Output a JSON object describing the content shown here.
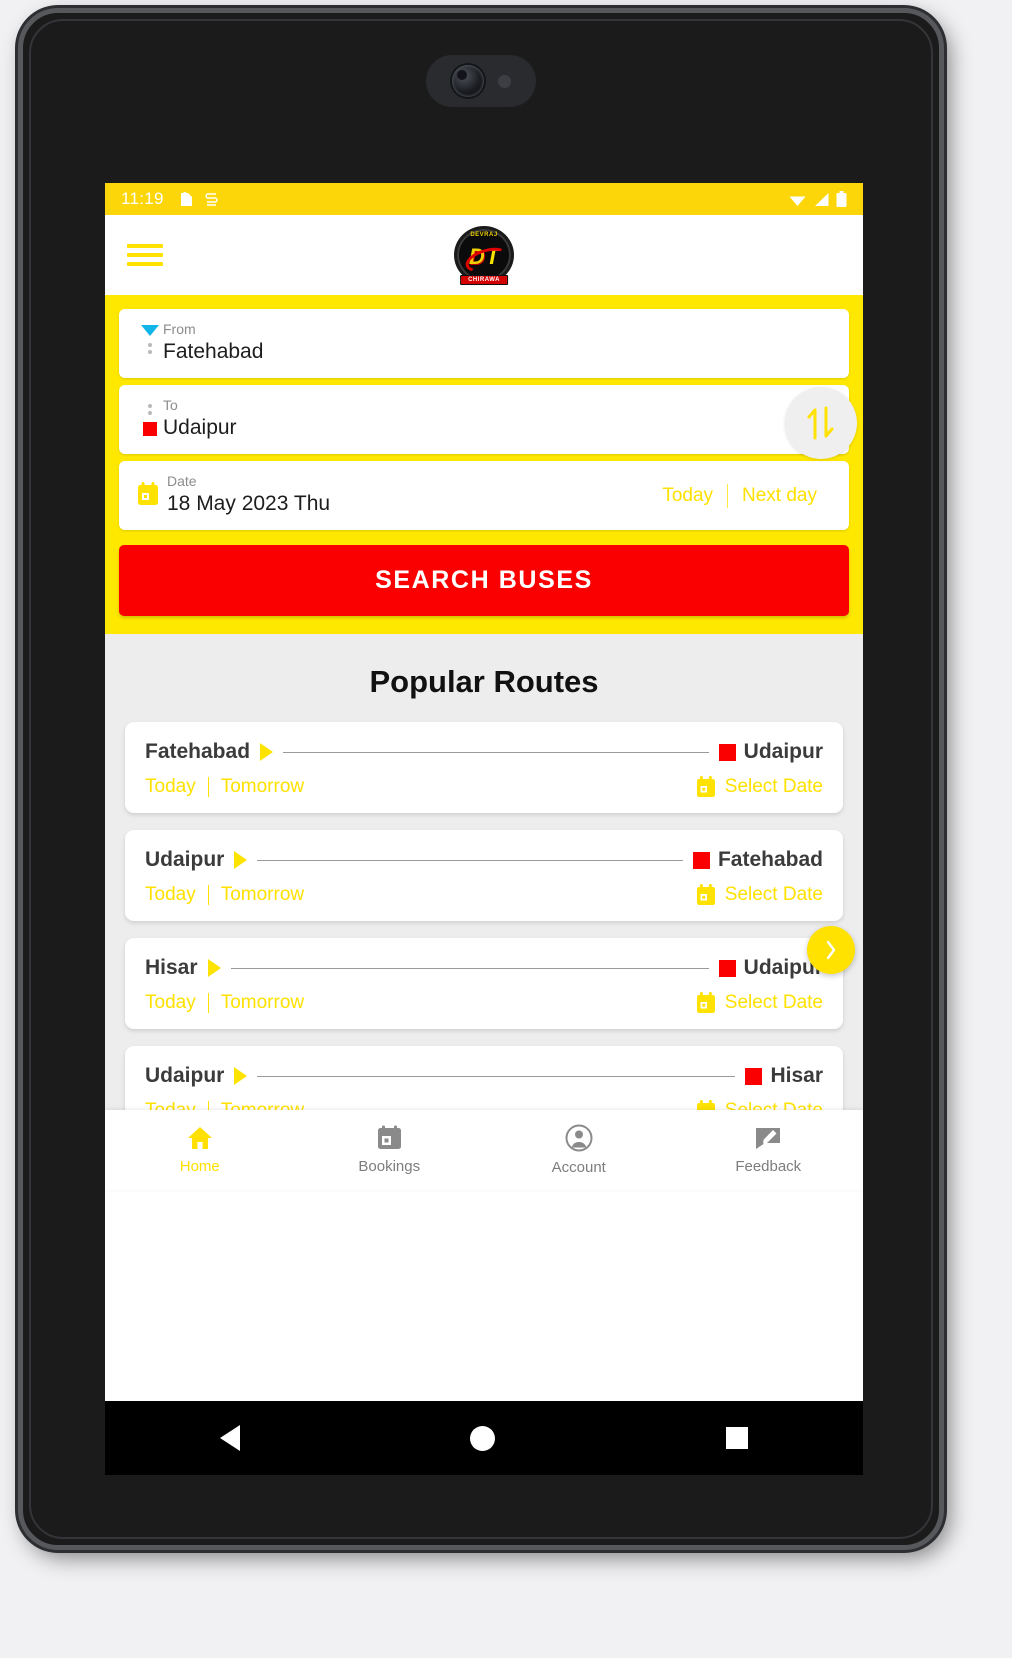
{
  "status_bar": {
    "time": "11:19",
    "icons": [
      "sim-card-icon",
      "usb-debug-icon",
      "wifi-icon",
      "signal-icon",
      "battery-icon"
    ]
  },
  "app_bar": {
    "menu_icon": "hamburger-menu-icon",
    "logo": {
      "top_text": "DEVRAJ",
      "letter_d": "D",
      "letter_t": "T",
      "banner_text": "CHIRAWA"
    }
  },
  "search_form": {
    "from": {
      "label": "From",
      "value": "Fatehabad",
      "marker": "triangle-down-blue"
    },
    "to": {
      "label": "To",
      "value": "Udaipur",
      "marker": "square-red"
    },
    "date": {
      "label": "Date",
      "value": "18 May 2023 Thu",
      "icon": "calendar-icon",
      "today_label": "Today",
      "next_day_label": "Next day"
    },
    "swap_icon": "swap-vertical-arrows-icon",
    "search_button_label": "SEARCH BUSES"
  },
  "popular_routes": {
    "title": "Popular Routes",
    "today_label": "Today",
    "tomorrow_label": "Tomorrow",
    "select_date_label": "Select Date",
    "next_fab_icon": "chevron-right-icon",
    "items": [
      {
        "origin": "Fatehabad",
        "destination": "Udaipur"
      },
      {
        "origin": "Udaipur",
        "destination": "Fatehabad"
      },
      {
        "origin": "Hisar",
        "destination": "Udaipur"
      },
      {
        "origin": "Udaipur",
        "destination": "Hisar"
      }
    ]
  },
  "bottom_nav": {
    "items": [
      {
        "label": "Home",
        "icon": "home-icon",
        "active": true
      },
      {
        "label": "Bookings",
        "icon": "bookings-calendar-icon",
        "active": false
      },
      {
        "label": "Account",
        "icon": "account-person-icon",
        "active": false
      },
      {
        "label": "Feedback",
        "icon": "feedback-edit-icon",
        "active": false
      }
    ]
  },
  "system_nav": {
    "back": "back-triangle-icon",
    "home": "home-circle-icon",
    "recents": "recents-square-icon"
  },
  "colors": {
    "brand_yellow": "#ffe800",
    "status_yellow": "#fdd609",
    "accent_red": "#fb0000",
    "marker_blue": "#12b5e8"
  }
}
